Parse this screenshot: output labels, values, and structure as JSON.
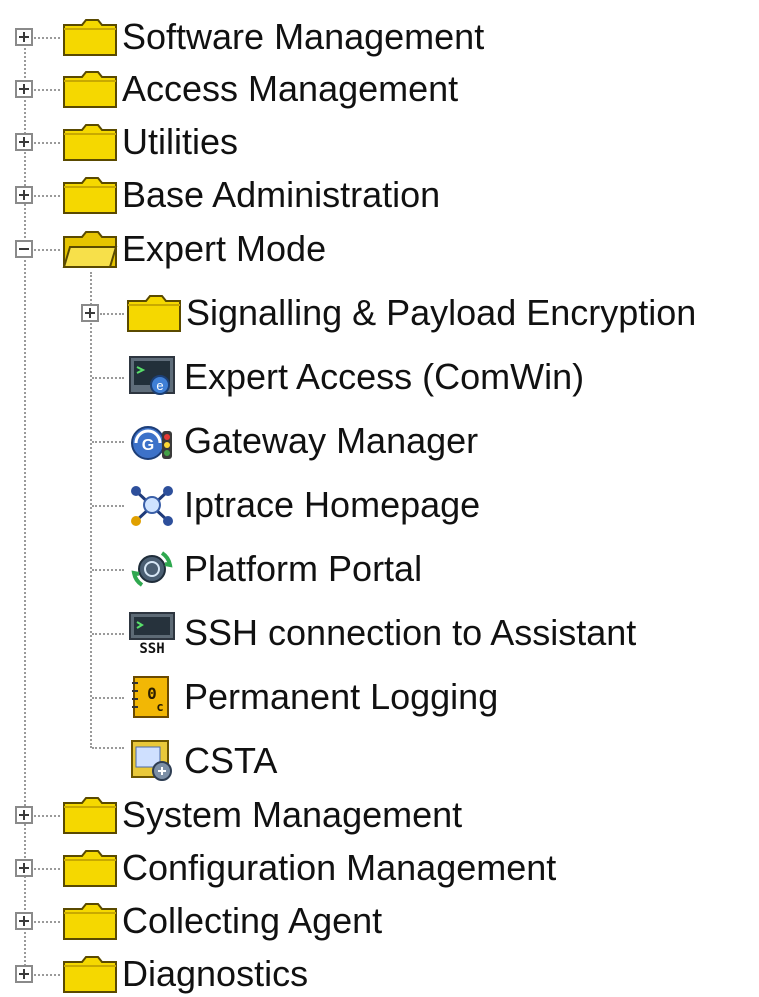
{
  "tree": {
    "top": [
      {
        "label": "Software Management",
        "icon": "folder-closed-icon",
        "state": "collapsed"
      },
      {
        "label": "Access Management",
        "icon": "folder-closed-icon",
        "state": "collapsed"
      },
      {
        "label": "Utilities",
        "icon": "folder-closed-icon",
        "state": "collapsed"
      },
      {
        "label": "Base Administration",
        "icon": "folder-closed-icon",
        "state": "collapsed"
      },
      {
        "label": "Expert Mode",
        "icon": "folder-open-icon",
        "state": "expanded"
      },
      {
        "label": "System Management",
        "icon": "folder-closed-icon",
        "state": "collapsed"
      },
      {
        "label": "Configuration Management",
        "icon": "folder-closed-icon",
        "state": "collapsed"
      },
      {
        "label": "Collecting Agent",
        "icon": "folder-closed-icon",
        "state": "collapsed"
      },
      {
        "label": "Diagnostics",
        "icon": "folder-closed-icon",
        "state": "collapsed"
      }
    ],
    "expert_children": [
      {
        "label": "Signalling & Payload Encryption",
        "icon": "folder-closed-icon",
        "state": "collapsed"
      },
      {
        "label": "Expert Access (ComWin)",
        "icon": "terminal-window-icon"
      },
      {
        "label": "Gateway Manager",
        "icon": "gateway-manager-icon"
      },
      {
        "label": "Iptrace Homepage",
        "icon": "network-trace-icon"
      },
      {
        "label": "Platform Portal",
        "icon": "portal-sync-icon"
      },
      {
        "label": "SSH connection to Assistant",
        "icon": "ssh-terminal-icon",
        "icon_text": "SSH"
      },
      {
        "label": "Permanent Logging",
        "icon": "log-book-icon"
      },
      {
        "label": "CSTA",
        "icon": "csta-app-icon"
      }
    ]
  },
  "colors": {
    "folder_fill": "#f5d800",
    "folder_stroke": "#5a4a00",
    "connector": "#9a9a9a"
  }
}
